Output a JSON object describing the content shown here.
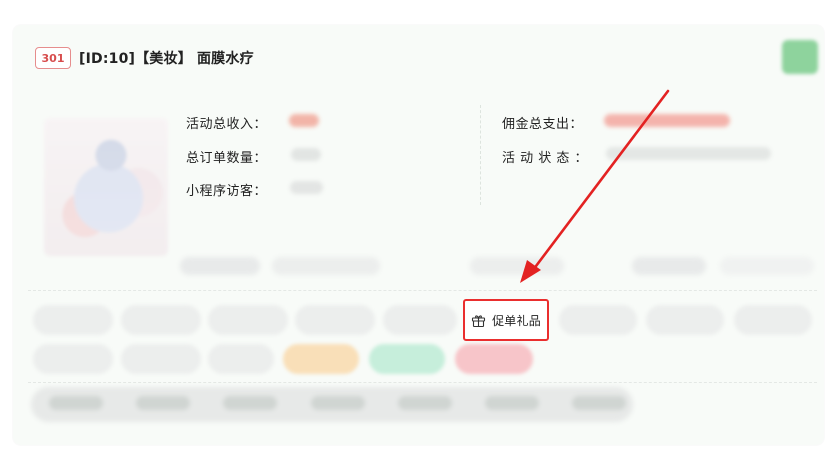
{
  "header": {
    "badge": "301",
    "title": "[ID:10]【美妆】 面膜水疗"
  },
  "metrics": {
    "left": [
      {
        "label": "活动总收入："
      },
      {
        "label": "总订单数量："
      },
      {
        "label": "小程序访客："
      }
    ],
    "right": [
      {
        "label": "佣金总支出："
      },
      {
        "label": "活 动 状 态 ："
      }
    ]
  },
  "actions": {
    "gift_label": "促单礼品"
  },
  "colors": {
    "accent_red": "#ea2e2e",
    "badge_red": "#d74d4d",
    "highlight_green": "#8ed39d",
    "blur_gray": "#eceeed"
  },
  "icons": {
    "gift": "gift-icon"
  }
}
